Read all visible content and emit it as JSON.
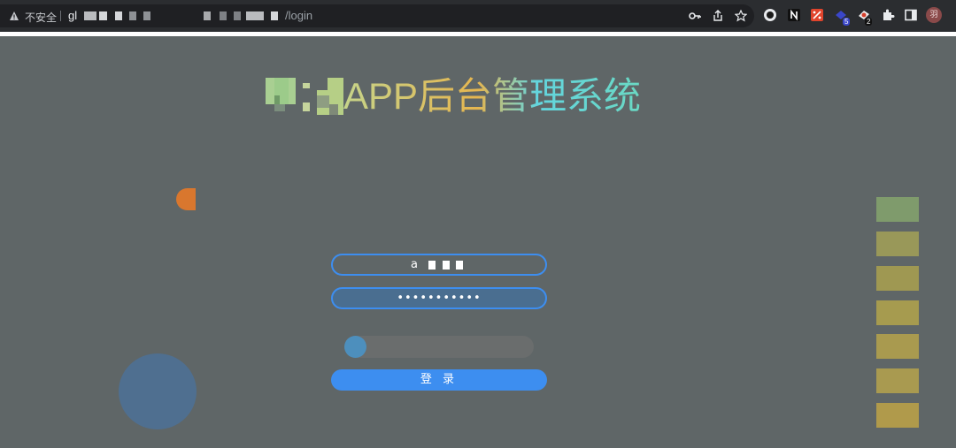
{
  "browser": {
    "security_label": "不安全",
    "url_host_prefix": "gl",
    "url_path": "/login",
    "extension_badges": [
      "5",
      "2"
    ],
    "profile_initial": "羽"
  },
  "page": {
    "title": "APP后台管理系统"
  },
  "form": {
    "username_value": "a",
    "password_value": "•••••••••••",
    "login_label": "登 录"
  },
  "slider": {
    "progress": 0
  },
  "colors": {
    "accent": "#3d8ef0",
    "background": "#5f6667",
    "deco_orange": "#d9772e",
    "deco_circle": "#4f6f90",
    "deco_squares": [
      "#7f9b6c",
      "#999859",
      "#9f9852",
      "#a69b4f",
      "#a99a4f",
      "#a99a50",
      "#b09a4b"
    ]
  },
  "icons": {
    "security": "warning-triangle-icon",
    "omnibox": [
      "key-icon",
      "share-icon",
      "star-icon"
    ],
    "extensions": [
      "circle-extension-icon",
      "n-extension-icon",
      "percent-extension-icon",
      "puzzle-badge-extension-icon",
      "candy-extension-icon",
      "puzzle-icon",
      "side-panel-icon"
    ]
  }
}
